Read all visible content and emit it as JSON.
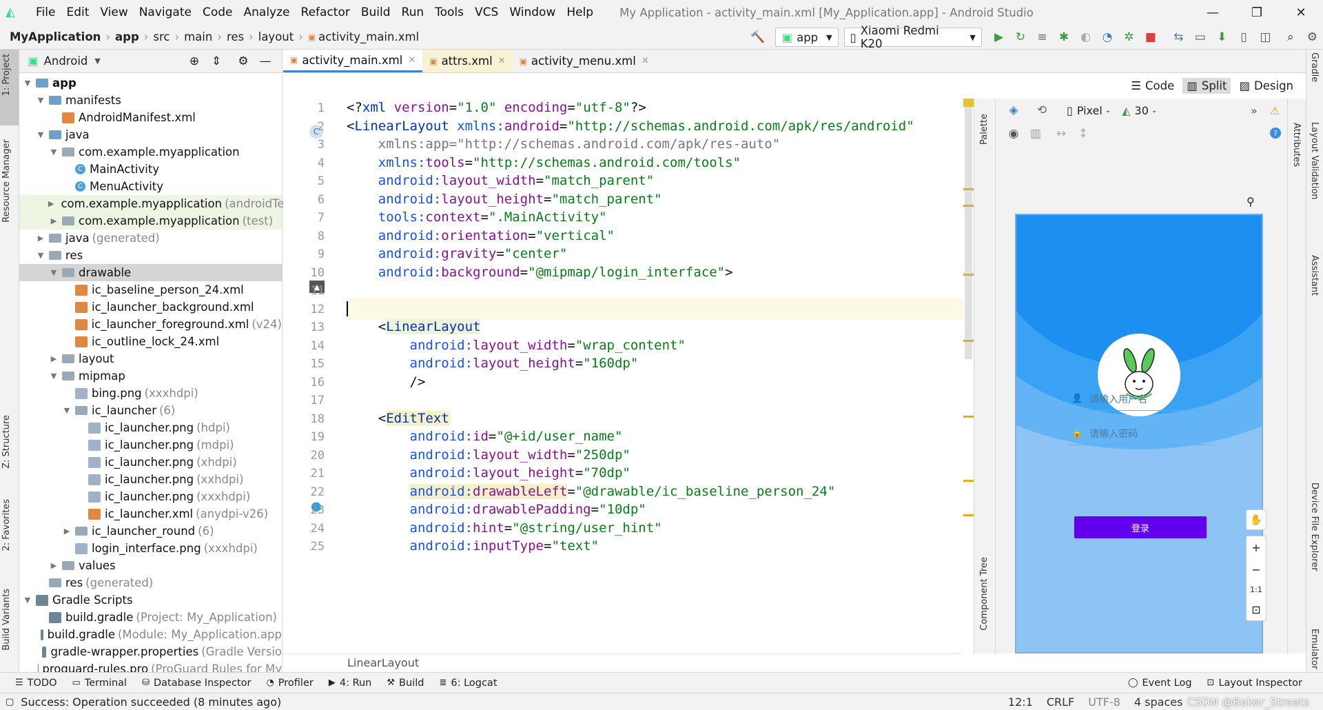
{
  "menubar": {
    "items": [
      "File",
      "Edit",
      "View",
      "Navigate",
      "Code",
      "Analyze",
      "Refactor",
      "Build",
      "Run",
      "Tools",
      "VCS",
      "Window",
      "Help"
    ],
    "title": "My Application - activity_main.xml [My_Application.app] - Android Studio"
  },
  "navbar": {
    "crumbs": [
      "MyApplication",
      "app",
      "src",
      "main",
      "res",
      "layout",
      "activity_main.xml"
    ],
    "run_config": "app",
    "device": "Xiaomi Redmi K20"
  },
  "left_strip": {
    "project": "1: Project",
    "resource_manager": "Resource Manager",
    "structure": "Z: Structure",
    "favorites": "2: Favorites",
    "build_variants": "Build Variants"
  },
  "right_strip": {
    "gradle": "Gradle",
    "layout_validation": "Layout Validation",
    "assistant": "Assistant",
    "device_file_explorer": "Device File Explorer",
    "emulator": "Emulator"
  },
  "project": {
    "view": "Android",
    "tree": [
      {
        "label": "app",
        "extra": "",
        "depth": 0,
        "icon": "folder",
        "arrow": "▼",
        "bold": true
      },
      {
        "label": "manifests",
        "extra": "",
        "depth": 1,
        "icon": "folder",
        "arrow": "▼"
      },
      {
        "label": "AndroidManifest.xml",
        "extra": "",
        "depth": 2,
        "icon": "xml",
        "arrow": ""
      },
      {
        "label": "java",
        "extra": "",
        "depth": 1,
        "icon": "folder",
        "arrow": "▼"
      },
      {
        "label": "com.example.myapplication",
        "extra": "",
        "depth": 2,
        "icon": "folderg",
        "arrow": "▼"
      },
      {
        "label": "MainActivity",
        "extra": "",
        "depth": 3,
        "icon": "cls",
        "arrow": ""
      },
      {
        "label": "MenuActivity",
        "extra": "",
        "depth": 3,
        "icon": "cls",
        "arrow": ""
      },
      {
        "label": "com.example.myapplication",
        "extra": "(androidTe",
        "depth": 2,
        "icon": "folderg",
        "arrow": "▶",
        "green": true
      },
      {
        "label": "com.example.myapplication",
        "extra": "(test)",
        "depth": 2,
        "icon": "folderg",
        "arrow": "▶",
        "green": true
      },
      {
        "label": "java",
        "extra": "(generated)",
        "depth": 1,
        "icon": "folderg",
        "arrow": "▶"
      },
      {
        "label": "res",
        "extra": "",
        "depth": 1,
        "icon": "folderg",
        "arrow": "▼"
      },
      {
        "label": "drawable",
        "extra": "",
        "depth": 2,
        "icon": "folderg",
        "arrow": "▼",
        "sel": true
      },
      {
        "label": "ic_baseline_person_24.xml",
        "extra": "",
        "depth": 3,
        "icon": "xml",
        "arrow": ""
      },
      {
        "label": "ic_launcher_background.xml",
        "extra": "",
        "depth": 3,
        "icon": "xml",
        "arrow": ""
      },
      {
        "label": "ic_launcher_foreground.xml",
        "extra": "(v24)",
        "depth": 3,
        "icon": "xml",
        "arrow": ""
      },
      {
        "label": "ic_outline_lock_24.xml",
        "extra": "",
        "depth": 3,
        "icon": "xml",
        "arrow": ""
      },
      {
        "label": "layout",
        "extra": "",
        "depth": 2,
        "icon": "folderg",
        "arrow": "▶"
      },
      {
        "label": "mipmap",
        "extra": "",
        "depth": 2,
        "icon": "folderg",
        "arrow": "▼"
      },
      {
        "label": "bing.png",
        "extra": "(xxxhdpi)",
        "depth": 3,
        "icon": "img",
        "arrow": ""
      },
      {
        "label": "ic_launcher",
        "extra": "(6)",
        "depth": 3,
        "icon": "folderg",
        "arrow": "▼"
      },
      {
        "label": "ic_launcher.png",
        "extra": "(hdpi)",
        "depth": 4,
        "icon": "img",
        "arrow": ""
      },
      {
        "label": "ic_launcher.png",
        "extra": "(mdpi)",
        "depth": 4,
        "icon": "img",
        "arrow": ""
      },
      {
        "label": "ic_launcher.png",
        "extra": "(xhdpi)",
        "depth": 4,
        "icon": "img",
        "arrow": ""
      },
      {
        "label": "ic_launcher.png",
        "extra": "(xxhdpi)",
        "depth": 4,
        "icon": "img",
        "arrow": ""
      },
      {
        "label": "ic_launcher.png",
        "extra": "(xxxhdpi)",
        "depth": 4,
        "icon": "img",
        "arrow": ""
      },
      {
        "label": "ic_launcher.xml",
        "extra": "(anydpi-v26)",
        "depth": 4,
        "icon": "xml",
        "arrow": ""
      },
      {
        "label": "ic_launcher_round",
        "extra": "(6)",
        "depth": 3,
        "icon": "folderg",
        "arrow": "▶"
      },
      {
        "label": "login_interface.png",
        "extra": "(xxxhdpi)",
        "depth": 3,
        "icon": "img",
        "arrow": ""
      },
      {
        "label": "values",
        "extra": "",
        "depth": 2,
        "icon": "folderg",
        "arrow": "▶"
      },
      {
        "label": "res",
        "extra": "(generated)",
        "depth": 1,
        "icon": "folderg",
        "arrow": ""
      },
      {
        "label": "Gradle Scripts",
        "extra": "",
        "depth": 0,
        "icon": "grd",
        "arrow": "▼"
      },
      {
        "label": "build.gradle",
        "extra": "(Project: My_Application)",
        "depth": 1,
        "icon": "grd",
        "arrow": ""
      },
      {
        "label": "build.gradle",
        "extra": "(Module: My_Application.app",
        "depth": 1,
        "icon": "grd",
        "arrow": ""
      },
      {
        "label": "gradle-wrapper.properties",
        "extra": "(Gradle Versio",
        "depth": 1,
        "icon": "grd",
        "arrow": ""
      },
      {
        "label": "proguard-rules.pro",
        "extra": "(ProGuard Rules for My",
        "depth": 1,
        "icon": "grd",
        "arrow": ""
      }
    ]
  },
  "tabs": [
    {
      "label": "activity_main.xml",
      "active": true
    },
    {
      "label": "attrs.xml",
      "yellow": true
    },
    {
      "label": "activity_menu.xml"
    }
  ],
  "modes": {
    "code": "Code",
    "split": "Split",
    "design": "Design"
  },
  "editor": {
    "lines": [
      [
        [
          "plain",
          "<?"
        ],
        [
          "tag",
          "xml "
        ],
        [
          "attr",
          "version"
        ],
        [
          "plain",
          "="
        ],
        [
          "str",
          "\"1.0\" "
        ],
        [
          "attr",
          "encoding"
        ],
        [
          "plain",
          "="
        ],
        [
          "str",
          "\"utf-8\""
        ],
        [
          "plain",
          "?>"
        ]
      ],
      [
        [
          "plain",
          "<"
        ],
        [
          "tag",
          "LinearLayout "
        ],
        [
          "ns",
          "xmlns:"
        ],
        [
          "attr",
          "android"
        ],
        [
          "plain",
          "="
        ],
        [
          "str",
          "\"http://schemas.android.com/apk/res/android\""
        ]
      ],
      [
        [
          "gray",
          "    xmlns:app=\"http://schemas.android.com/apk/res-auto\""
        ]
      ],
      [
        [
          "plain",
          "    "
        ],
        [
          "ns",
          "xmlns:"
        ],
        [
          "attr",
          "tools"
        ],
        [
          "plain",
          "="
        ],
        [
          "str",
          "\"http://schemas.android.com/tools\""
        ]
      ],
      [
        [
          "plain",
          "    "
        ],
        [
          "ns",
          "android:"
        ],
        [
          "attr",
          "layout_width"
        ],
        [
          "plain",
          "="
        ],
        [
          "str",
          "\"match_parent\""
        ]
      ],
      [
        [
          "plain",
          "    "
        ],
        [
          "ns",
          "android:"
        ],
        [
          "attr",
          "layout_height"
        ],
        [
          "plain",
          "="
        ],
        [
          "str",
          "\"match_parent\""
        ]
      ],
      [
        [
          "plain",
          "    "
        ],
        [
          "ns",
          "tools:"
        ],
        [
          "attr",
          "context"
        ],
        [
          "plain",
          "="
        ],
        [
          "str",
          "\".MainActivity\""
        ]
      ],
      [
        [
          "plain",
          "    "
        ],
        [
          "ns",
          "android:"
        ],
        [
          "attr",
          "orientation"
        ],
        [
          "plain",
          "="
        ],
        [
          "str",
          "\"vertical\""
        ]
      ],
      [
        [
          "plain",
          "    "
        ],
        [
          "ns",
          "android:"
        ],
        [
          "attr",
          "gravity"
        ],
        [
          "plain",
          "="
        ],
        [
          "str",
          "\"center\""
        ]
      ],
      [
        [
          "plain",
          "    "
        ],
        [
          "ns",
          "android:"
        ],
        [
          "attr",
          "background"
        ],
        [
          "plain",
          "="
        ],
        [
          "str",
          "\"@mipmap/login_interface\""
        ],
        [
          "plain",
          ">"
        ]
      ],
      [],
      [],
      [
        [
          "plain",
          "    <"
        ],
        [
          "taghl",
          "LinearLayout"
        ]
      ],
      [
        [
          "plain",
          "        "
        ],
        [
          "ns",
          "android:"
        ],
        [
          "attr",
          "layout_width"
        ],
        [
          "plain",
          "="
        ],
        [
          "str",
          "\"wrap_content\""
        ]
      ],
      [
        [
          "plain",
          "        "
        ],
        [
          "ns",
          "android:"
        ],
        [
          "attr",
          "layout_height"
        ],
        [
          "plain",
          "="
        ],
        [
          "str",
          "\"160dp\""
        ]
      ],
      [
        [
          "plain",
          "        />"
        ]
      ],
      [],
      [
        [
          "plain",
          "    <"
        ],
        [
          "tagy",
          "EditText"
        ]
      ],
      [
        [
          "plain",
          "        "
        ],
        [
          "ns",
          "android:"
        ],
        [
          "attr",
          "id"
        ],
        [
          "plain",
          "="
        ],
        [
          "str",
          "\"@+id/user_name\""
        ]
      ],
      [
        [
          "plain",
          "        "
        ],
        [
          "ns",
          "android:"
        ],
        [
          "attr",
          "layout_width"
        ],
        [
          "plain",
          "="
        ],
        [
          "str",
          "\"250dp\""
        ]
      ],
      [
        [
          "plain",
          "        "
        ],
        [
          "ns",
          "android:"
        ],
        [
          "attr",
          "layout_height"
        ],
        [
          "plain",
          "="
        ],
        [
          "str",
          "\"70dp\""
        ]
      ],
      [
        [
          "plain",
          "        "
        ],
        [
          "nsy",
          "android:"
        ],
        [
          "attry",
          "drawableLeft"
        ],
        [
          "plain",
          "="
        ],
        [
          "str",
          "\"@drawable/ic_baseline_person_24\""
        ]
      ],
      [
        [
          "plain",
          "        "
        ],
        [
          "ns",
          "android:"
        ],
        [
          "attr",
          "drawablePadding"
        ],
        [
          "plain",
          "="
        ],
        [
          "str",
          "\"10dp\""
        ]
      ],
      [
        [
          "plain",
          "        "
        ],
        [
          "ns",
          "android:"
        ],
        [
          "attr",
          "hint"
        ],
        [
          "plain",
          "="
        ],
        [
          "str",
          "\"@string/user_hint\""
        ]
      ],
      [
        [
          "plain",
          "        "
        ],
        [
          "ns",
          "android:"
        ],
        [
          "attr",
          "inputType"
        ],
        [
          "plain",
          "="
        ],
        [
          "str",
          "\"text\""
        ]
      ]
    ],
    "breadcrumb": "LinearLayout",
    "current_line": 12
  },
  "design": {
    "palette": "Palette",
    "component_tree": "Component Tree",
    "attributes": "Attributes",
    "device": "Pixel",
    "api": "30",
    "preview": {
      "username_hint": "请输入用户名",
      "password_hint": "请输入密码",
      "login_button": "登录"
    },
    "zoom": {
      "plus": "+",
      "minus": "−",
      "one": "1:1"
    }
  },
  "bottom_tools": {
    "left": [
      "TODO",
      "Terminal",
      "Database Inspector",
      "Profiler",
      "4: Run",
      "Build",
      "6: Logcat"
    ],
    "right": [
      "Event Log",
      "Layout Inspector"
    ]
  },
  "status": {
    "message": "Success: Operation succeeded (8 minutes ago)",
    "position": "12:1",
    "line_sep": "CRLF",
    "encoding": "UTF-8",
    "indent": "4 spaces",
    "watermark": "CSDN @Baker_Streets"
  },
  "colors": {
    "accent": "#4083c9",
    "login_button": "#6200ee",
    "phone_bg": "#8ec4f5"
  }
}
